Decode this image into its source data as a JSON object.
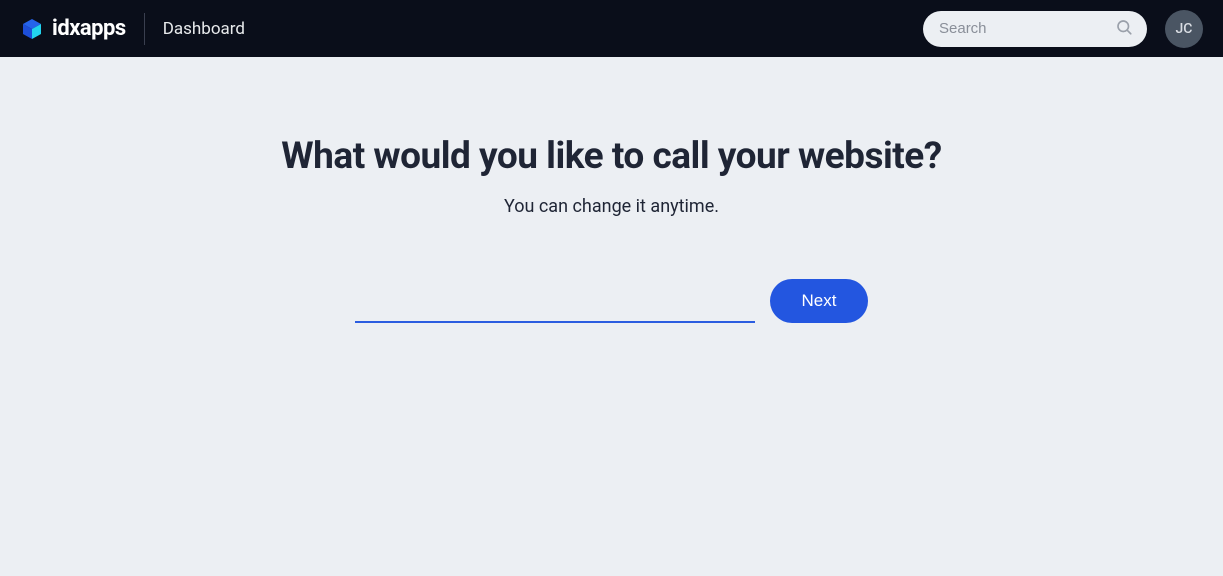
{
  "header": {
    "brand": "idxapps",
    "nav_item": "Dashboard",
    "search_placeholder": "Search",
    "avatar_initials": "JC"
  },
  "main": {
    "title": "What would you like to call your website?",
    "subtitle": "You can change it anytime.",
    "website_name_value": "",
    "next_label": "Next"
  }
}
